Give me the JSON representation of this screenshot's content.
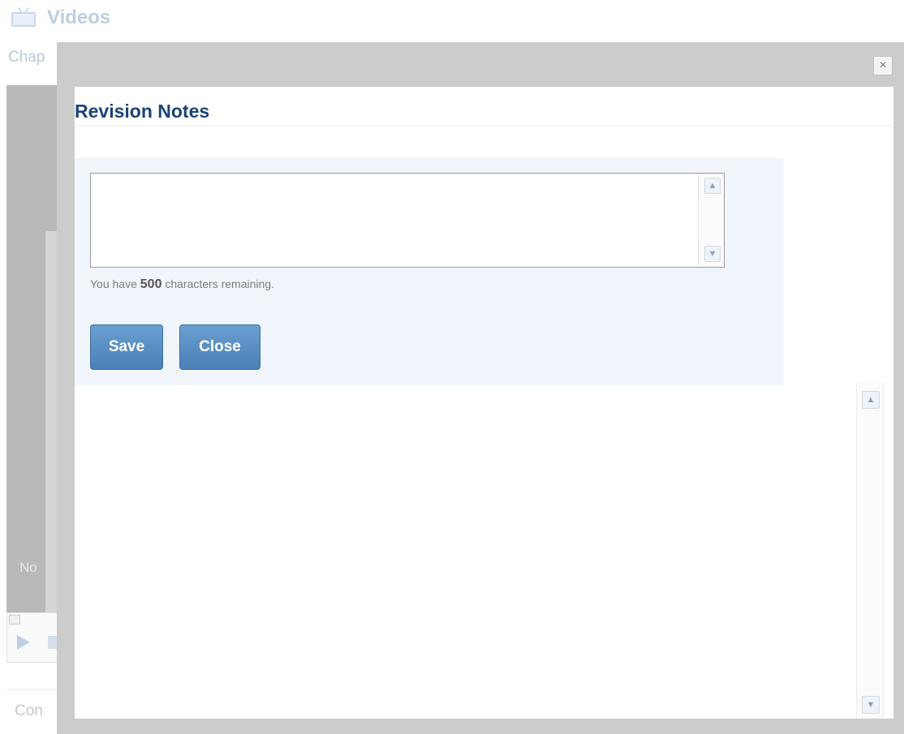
{
  "background": {
    "title": "Videos",
    "title_icon": "tv-icon",
    "chapter_text": "Chap",
    "video_label": "No",
    "footer_text": "Con"
  },
  "modal": {
    "close_glyph": "×",
    "title": "Revision Notes",
    "textarea_value": "",
    "remaining_prefix": "You have",
    "remaining_count": "500",
    "remaining_suffix": "characters remaining.",
    "save_label": "Save",
    "close_label": "Close",
    "scroll_up_glyph": "▲",
    "scroll_down_glyph": "▼"
  },
  "colors": {
    "title_blue": "#1b4377",
    "button_blue": "#4a80b8",
    "overlay_gray": "#cccccc",
    "panel_bg": "#eff5fa"
  }
}
